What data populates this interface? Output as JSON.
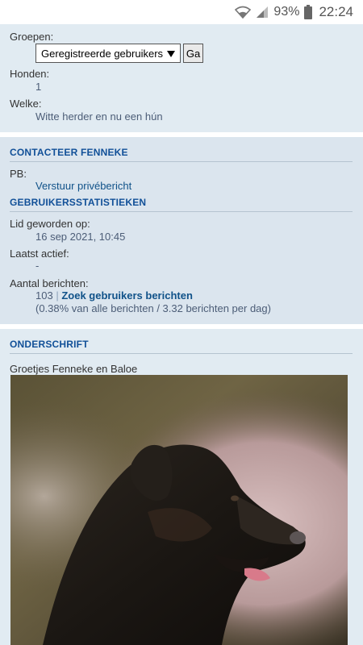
{
  "status_bar": {
    "battery_percent": "93%",
    "time": "22:24",
    "icons": [
      "wifi-icon",
      "signal-icon",
      "battery-icon"
    ]
  },
  "profile": {
    "groups_label": "Groepen:",
    "groups_selected": "Geregistreerde gebruikers",
    "go_label": "Ga",
    "dogs_label": "Honden:",
    "dogs_value": "1",
    "which_label": "Welke:",
    "which_value": "Witte herder en nu een hún"
  },
  "contact": {
    "heading": "CONTACTEER FENNEKE",
    "pm_label": "PB:",
    "pm_link": "Verstuur privébericht"
  },
  "stats": {
    "heading": "GEBRUIKERSSTATISTIEKEN",
    "joined_label": "Lid geworden op:",
    "joined_value": "16 sep 2021, 10:45",
    "last_active_label": "Laatst actief:",
    "last_active_value": "-",
    "posts_label": "Aantal berichten:",
    "posts_count": "103",
    "posts_separator": "|",
    "posts_link": "Zoek gebruikers berichten",
    "posts_detail": "(0.38% van alle berichten / 3.32 berichten per dag)"
  },
  "signature": {
    "heading": "ONDERSCHRIFT",
    "text": "Groetjes Fenneke en Baloe"
  }
}
